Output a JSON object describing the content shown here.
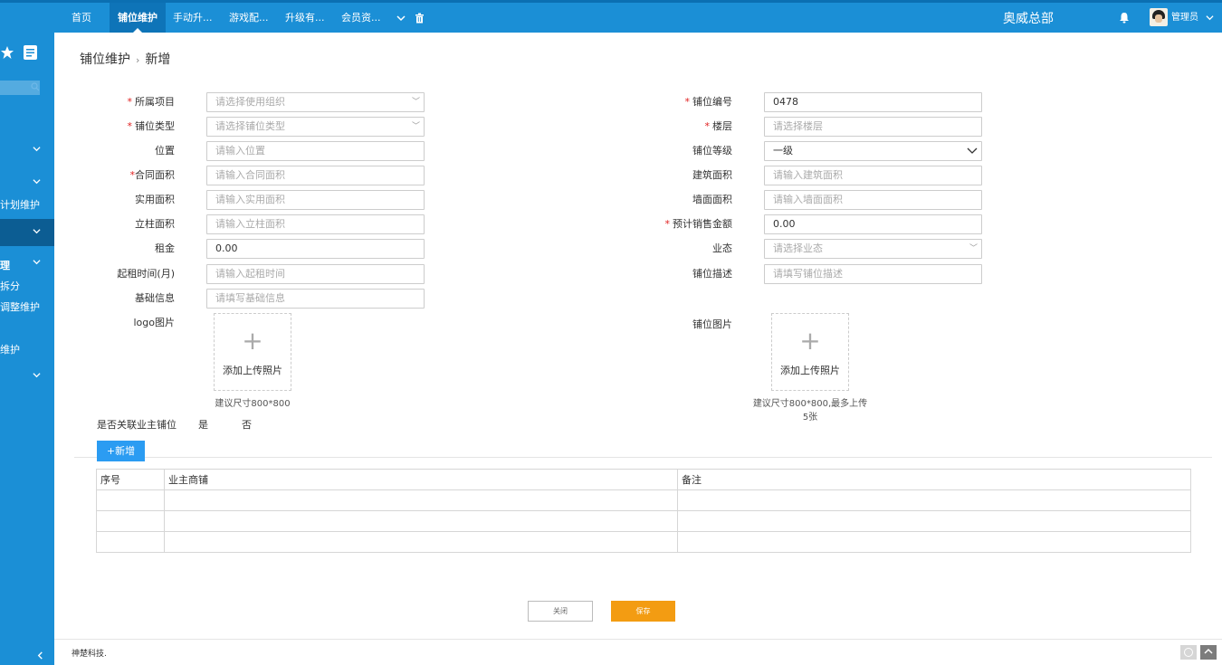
{
  "topbar": {
    "tabs": [
      {
        "label": "首页",
        "active": false
      },
      {
        "label": "铺位维护",
        "active": true
      },
      {
        "label": "手动升...",
        "active": false
      },
      {
        "label": "游戏配...",
        "active": false
      },
      {
        "label": "升级有...",
        "active": false
      },
      {
        "label": "会员资...",
        "active": false
      }
    ],
    "more_icon": "chevron-down",
    "delete_icon": "trash",
    "org_name": "奥威总部",
    "bell_icon": "bell",
    "user_name": "管理员"
  },
  "sidebar": {
    "items": [
      {
        "label": ""
      },
      {
        "label": ""
      },
      {
        "label": "计划维护"
      },
      {
        "label": ""
      },
      {
        "label": "理"
      },
      {
        "label": "拆分"
      },
      {
        "label": "调整维护"
      },
      {
        "label": "维护"
      },
      {
        "label": ""
      }
    ],
    "collapse_icon": "chevron-left"
  },
  "breadcrumb": {
    "parent": "铺位维护",
    "current": "新增"
  },
  "form": {
    "project": {
      "label": "所属项目",
      "required": true,
      "placeholder": "请选择使用组织"
    },
    "shop_no": {
      "label": "铺位编号",
      "required": true,
      "value": "0478"
    },
    "shop_type": {
      "label": "铺位类型",
      "required": true,
      "placeholder": "请选择铺位类型"
    },
    "floor": {
      "label": "楼层",
      "required": true,
      "placeholder": "请选择楼层"
    },
    "location": {
      "label": "位置",
      "placeholder": "请输入位置"
    },
    "grade": {
      "label": "铺位等级",
      "value": "一级"
    },
    "contract_area": {
      "label": "合同面积",
      "required": true,
      "placeholder": "请输入合同面积"
    },
    "building_area": {
      "label": "建筑面积",
      "placeholder": "请输入建筑面积"
    },
    "usable_area": {
      "label": "实用面积",
      "placeholder": "请输入实用面积"
    },
    "wall_area": {
      "label": "墙面面积",
      "placeholder": "请输入墙面面积"
    },
    "column_area": {
      "label": "立柱面积",
      "placeholder": "请输入立柱面积"
    },
    "expected_sales": {
      "label": "预计销售金额",
      "required": true,
      "value": "0.00"
    },
    "rent": {
      "label": "租金",
      "value": "0.00"
    },
    "business_type": {
      "label": "业态",
      "placeholder": "请选择业态"
    },
    "rent_start": {
      "label": "起租时间(月)",
      "placeholder": "请输入起租时间"
    },
    "shop_desc": {
      "label": "铺位描述",
      "placeholder": "请填写铺位描述"
    },
    "basic_info": {
      "label": "基础信息",
      "placeholder": "请填写基础信息"
    },
    "logo": {
      "label": "logo图片",
      "upload_text": "添加上传照片",
      "hint": "建议尺寸800*800"
    },
    "shop_image": {
      "label": "铺位图片",
      "upload_text": "添加上传照片",
      "hint_line1": "建议尺寸800*800,最多上传",
      "hint_line2": "5张"
    },
    "link_owner": {
      "label": "是否关联业主铺位",
      "yes": "是",
      "no": "否"
    }
  },
  "owner_table": {
    "add_label": "+新增",
    "headers": [
      "序号",
      "业主商铺",
      "备注"
    ],
    "rows": 3
  },
  "actions": {
    "close_label": "关闭",
    "save_label": "保存"
  },
  "footer": {
    "text": "神楚科技."
  },
  "colors": {
    "topbar": "#1b8fd6",
    "primary": "#2b9cf2",
    "save": "#f39c12",
    "required": "#e02020"
  }
}
